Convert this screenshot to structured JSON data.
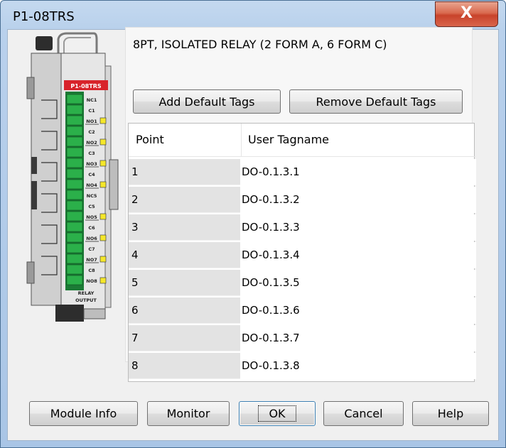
{
  "window": {
    "title": "P1-08TRS",
    "close_glyph": "X"
  },
  "module": {
    "description": "8PT, ISOLATED RELAY (2 FORM A, 6 FORM C)",
    "label": "P1-08TRS",
    "terminals": [
      "NC1",
      "C1",
      "NO1",
      "C2",
      "NO2",
      "C3",
      "NO3",
      "C4",
      "NO4",
      "NC5",
      "C5",
      "NO5",
      "C6",
      "NO6",
      "C7",
      "NO7",
      "C8",
      "NO8"
    ],
    "footer_line1": "RELAY",
    "footer_line2": "OUTPUT",
    "colors": {
      "red_label": "#d8232a",
      "green_terminal": "#2bb04a",
      "yellow_led": "#f5e72a"
    }
  },
  "buttons": {
    "add_default": "Add Default Tags",
    "remove_default": "Remove Default Tags",
    "module_info": "Module Info",
    "monitor": "Monitor",
    "ok": "OK",
    "cancel": "Cancel",
    "help": "Help"
  },
  "table": {
    "headers": {
      "point": "Point",
      "tag": "User Tagname"
    },
    "rows": [
      {
        "point": "1",
        "tag": "DO-0.1.3.1"
      },
      {
        "point": "2",
        "tag": "DO-0.1.3.2"
      },
      {
        "point": "3",
        "tag": "DO-0.1.3.3"
      },
      {
        "point": "4",
        "tag": "DO-0.1.3.4"
      },
      {
        "point": "5",
        "tag": "DO-0.1.3.5"
      },
      {
        "point": "6",
        "tag": "DO-0.1.3.6"
      },
      {
        "point": "7",
        "tag": "DO-0.1.3.7"
      },
      {
        "point": "8",
        "tag": "DO-0.1.3.8"
      }
    ]
  }
}
